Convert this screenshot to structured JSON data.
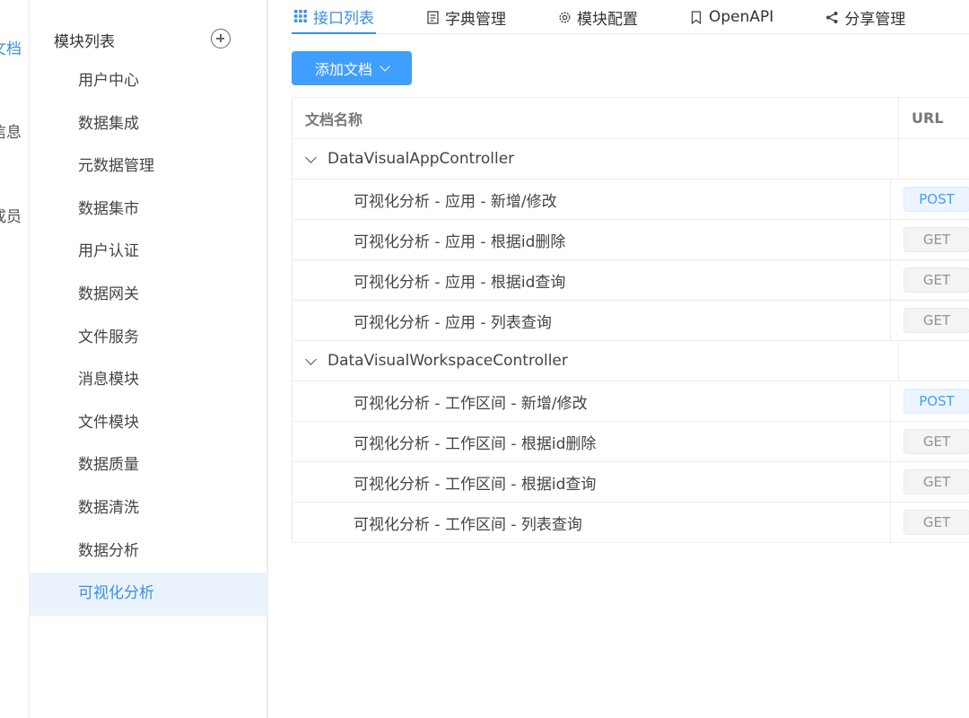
{
  "left_nav": {
    "items": [
      {
        "label": "文档",
        "active": true
      },
      {
        "label": "信息",
        "active": false
      },
      {
        "label": "成员",
        "active": false
      }
    ]
  },
  "module_sidebar": {
    "title": "模块列表",
    "items": [
      {
        "label": "用户中心"
      },
      {
        "label": "数据集成"
      },
      {
        "label": "元数据管理"
      },
      {
        "label": "数据集市"
      },
      {
        "label": "用户认证"
      },
      {
        "label": "数据网关"
      },
      {
        "label": "文件服务"
      },
      {
        "label": "消息模块"
      },
      {
        "label": "文件模块"
      },
      {
        "label": "数据质量"
      },
      {
        "label": "数据清洗"
      },
      {
        "label": "数据分析"
      },
      {
        "label": "可视化分析",
        "active": true
      }
    ]
  },
  "tabs": [
    {
      "label": "接口列表",
      "icon": "grid-icon",
      "active": true
    },
    {
      "label": "字典管理",
      "icon": "document-icon",
      "active": false
    },
    {
      "label": "模块配置",
      "icon": "gear-icon",
      "active": false
    },
    {
      "label": "OpenAPI",
      "icon": "bookmark-icon",
      "active": false
    },
    {
      "label": "分享管理",
      "icon": "share-icon",
      "active": false
    }
  ],
  "toolbar": {
    "add_doc_label": "添加文档"
  },
  "table": {
    "headers": {
      "name": "文档名称",
      "url": "URL"
    },
    "groups": [
      {
        "name": "DataVisualAppController",
        "rows": [
          {
            "name": "可视化分析 - 应用 - 新增/修改",
            "method": "POST"
          },
          {
            "name": "可视化分析 - 应用 - 根据id删除",
            "method": "GET"
          },
          {
            "name": "可视化分析 - 应用 - 根据id查询",
            "method": "GET"
          },
          {
            "name": "可视化分析 - 应用 - 列表查询",
            "method": "GET"
          }
        ]
      },
      {
        "name": "DataVisualWorkspaceController",
        "rows": [
          {
            "name": "可视化分析 - 工作区间 - 新增/修改",
            "method": "POST"
          },
          {
            "name": "可视化分析 - 工作区间 - 根据id删除",
            "method": "GET"
          },
          {
            "name": "可视化分析 - 工作区间 - 根据id查询",
            "method": "GET"
          },
          {
            "name": "可视化分析 - 工作区间 - 列表查询",
            "method": "GET"
          }
        ]
      }
    ]
  },
  "colors": {
    "accent": "#409eff",
    "active_bg": "#eaf3fd"
  }
}
